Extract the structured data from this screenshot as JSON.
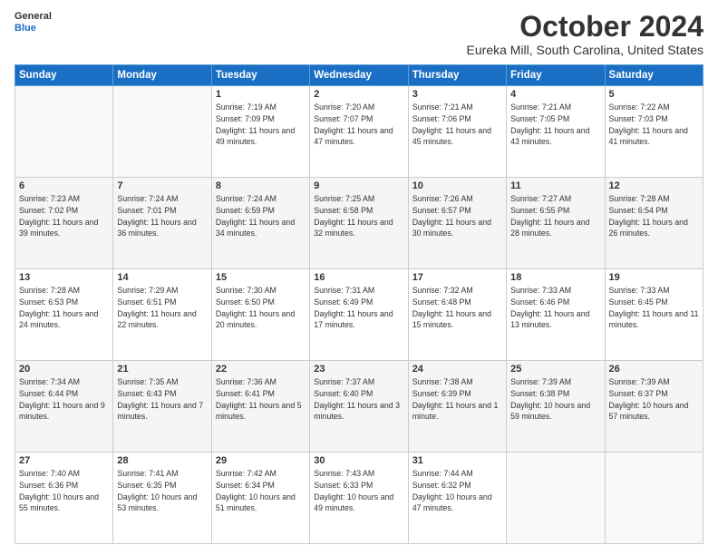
{
  "logo": {
    "line1": "General",
    "line2": "Blue"
  },
  "title": "October 2024",
  "location": "Eureka Mill, South Carolina, United States",
  "days_of_week": [
    "Sunday",
    "Monday",
    "Tuesday",
    "Wednesday",
    "Thursday",
    "Friday",
    "Saturday"
  ],
  "weeks": [
    [
      {
        "day": "",
        "info": ""
      },
      {
        "day": "",
        "info": ""
      },
      {
        "day": "1",
        "info": "Sunrise: 7:19 AM\nSunset: 7:09 PM\nDaylight: 11 hours and 49 minutes."
      },
      {
        "day": "2",
        "info": "Sunrise: 7:20 AM\nSunset: 7:07 PM\nDaylight: 11 hours and 47 minutes."
      },
      {
        "day": "3",
        "info": "Sunrise: 7:21 AM\nSunset: 7:06 PM\nDaylight: 11 hours and 45 minutes."
      },
      {
        "day": "4",
        "info": "Sunrise: 7:21 AM\nSunset: 7:05 PM\nDaylight: 11 hours and 43 minutes."
      },
      {
        "day": "5",
        "info": "Sunrise: 7:22 AM\nSunset: 7:03 PM\nDaylight: 11 hours and 41 minutes."
      }
    ],
    [
      {
        "day": "6",
        "info": "Sunrise: 7:23 AM\nSunset: 7:02 PM\nDaylight: 11 hours and 39 minutes."
      },
      {
        "day": "7",
        "info": "Sunrise: 7:24 AM\nSunset: 7:01 PM\nDaylight: 11 hours and 36 minutes."
      },
      {
        "day": "8",
        "info": "Sunrise: 7:24 AM\nSunset: 6:59 PM\nDaylight: 11 hours and 34 minutes."
      },
      {
        "day": "9",
        "info": "Sunrise: 7:25 AM\nSunset: 6:58 PM\nDaylight: 11 hours and 32 minutes."
      },
      {
        "day": "10",
        "info": "Sunrise: 7:26 AM\nSunset: 6:57 PM\nDaylight: 11 hours and 30 minutes."
      },
      {
        "day": "11",
        "info": "Sunrise: 7:27 AM\nSunset: 6:55 PM\nDaylight: 11 hours and 28 minutes."
      },
      {
        "day": "12",
        "info": "Sunrise: 7:28 AM\nSunset: 6:54 PM\nDaylight: 11 hours and 26 minutes."
      }
    ],
    [
      {
        "day": "13",
        "info": "Sunrise: 7:28 AM\nSunset: 6:53 PM\nDaylight: 11 hours and 24 minutes."
      },
      {
        "day": "14",
        "info": "Sunrise: 7:29 AM\nSunset: 6:51 PM\nDaylight: 11 hours and 22 minutes."
      },
      {
        "day": "15",
        "info": "Sunrise: 7:30 AM\nSunset: 6:50 PM\nDaylight: 11 hours and 20 minutes."
      },
      {
        "day": "16",
        "info": "Sunrise: 7:31 AM\nSunset: 6:49 PM\nDaylight: 11 hours and 17 minutes."
      },
      {
        "day": "17",
        "info": "Sunrise: 7:32 AM\nSunset: 6:48 PM\nDaylight: 11 hours and 15 minutes."
      },
      {
        "day": "18",
        "info": "Sunrise: 7:33 AM\nSunset: 6:46 PM\nDaylight: 11 hours and 13 minutes."
      },
      {
        "day": "19",
        "info": "Sunrise: 7:33 AM\nSunset: 6:45 PM\nDaylight: 11 hours and 11 minutes."
      }
    ],
    [
      {
        "day": "20",
        "info": "Sunrise: 7:34 AM\nSunset: 6:44 PM\nDaylight: 11 hours and 9 minutes."
      },
      {
        "day": "21",
        "info": "Sunrise: 7:35 AM\nSunset: 6:43 PM\nDaylight: 11 hours and 7 minutes."
      },
      {
        "day": "22",
        "info": "Sunrise: 7:36 AM\nSunset: 6:41 PM\nDaylight: 11 hours and 5 minutes."
      },
      {
        "day": "23",
        "info": "Sunrise: 7:37 AM\nSunset: 6:40 PM\nDaylight: 11 hours and 3 minutes."
      },
      {
        "day": "24",
        "info": "Sunrise: 7:38 AM\nSunset: 6:39 PM\nDaylight: 11 hours and 1 minute."
      },
      {
        "day": "25",
        "info": "Sunrise: 7:39 AM\nSunset: 6:38 PM\nDaylight: 10 hours and 59 minutes."
      },
      {
        "day": "26",
        "info": "Sunrise: 7:39 AM\nSunset: 6:37 PM\nDaylight: 10 hours and 57 minutes."
      }
    ],
    [
      {
        "day": "27",
        "info": "Sunrise: 7:40 AM\nSunset: 6:36 PM\nDaylight: 10 hours and 55 minutes."
      },
      {
        "day": "28",
        "info": "Sunrise: 7:41 AM\nSunset: 6:35 PM\nDaylight: 10 hours and 53 minutes."
      },
      {
        "day": "29",
        "info": "Sunrise: 7:42 AM\nSunset: 6:34 PM\nDaylight: 10 hours and 51 minutes."
      },
      {
        "day": "30",
        "info": "Sunrise: 7:43 AM\nSunset: 6:33 PM\nDaylight: 10 hours and 49 minutes."
      },
      {
        "day": "31",
        "info": "Sunrise: 7:44 AM\nSunset: 6:32 PM\nDaylight: 10 hours and 47 minutes."
      },
      {
        "day": "",
        "info": ""
      },
      {
        "day": "",
        "info": ""
      }
    ]
  ]
}
